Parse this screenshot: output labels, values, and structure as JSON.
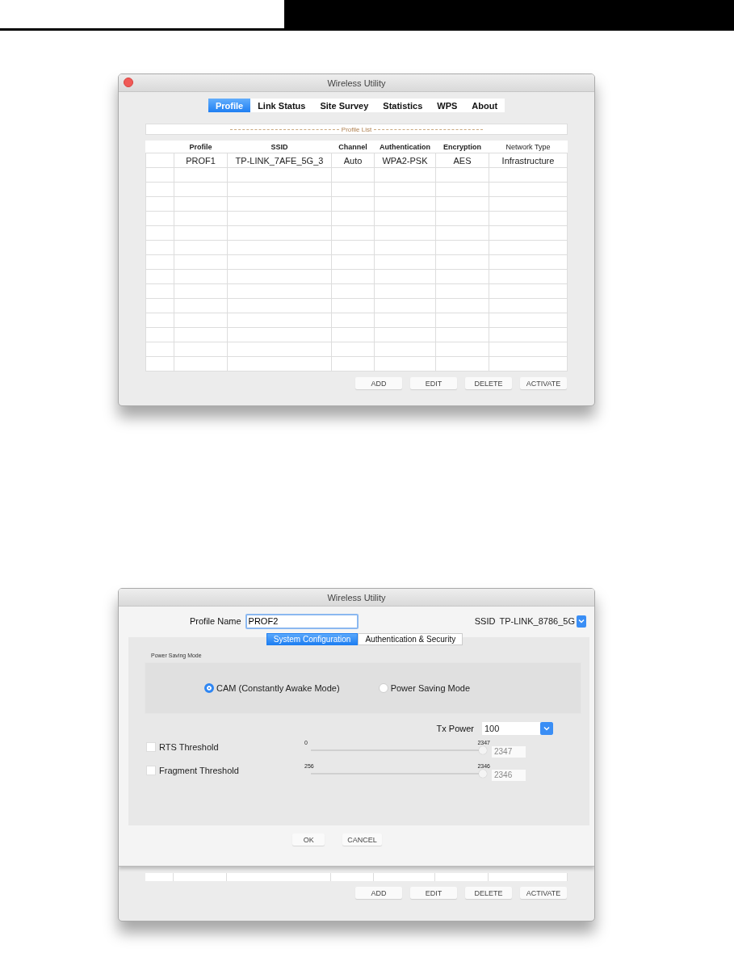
{
  "profile_window": {
    "title": "Wireless Utility",
    "tabs": [
      {
        "label": "Profile",
        "selected": true
      },
      {
        "label": "Link Status",
        "selected": false
      },
      {
        "label": "Site Survey",
        "selected": false
      },
      {
        "label": "Statistics",
        "selected": false
      },
      {
        "label": "WPS",
        "selected": false
      },
      {
        "label": "About",
        "selected": false
      }
    ],
    "list_title": "Profile List",
    "table": {
      "columns": [
        "Profile",
        "SSID",
        "Channel",
        "Authentication",
        "Encryption",
        "Network Type"
      ],
      "rows": [
        [
          "PROF1",
          "TP-LINK_7AFE_5G_3",
          "Auto",
          "WPA2-PSK",
          "AES",
          "Infrastructure"
        ]
      ]
    },
    "buttons": [
      "ADD",
      "EDIT",
      "DELETE",
      "ACTIVATE"
    ]
  },
  "config_window": {
    "title": "Wireless Utility",
    "profile_name": {
      "label": "Profile Name",
      "value": "PROF2"
    },
    "ssid": {
      "label": "SSID",
      "value": "TP-LINK_8786_5G"
    },
    "tabs": [
      {
        "label": "System Configuration",
        "selected": true
      },
      {
        "label": "Authentication & Security",
        "selected": false
      }
    ],
    "power_saving": {
      "title": "Power Saving Mode",
      "options": [
        {
          "label": "CAM (Constantly Awake Mode)",
          "selected": true
        },
        {
          "label": "Power Saving Mode",
          "selected": false
        }
      ]
    },
    "tx_power": {
      "label": "Tx Power",
      "value": "100"
    },
    "thresholds": [
      {
        "label": "RTS Threshold",
        "checked": false,
        "min": "0",
        "max": "2347",
        "level": 1,
        "value": "2347"
      },
      {
        "label": "Fragment Threshold",
        "checked": false,
        "min": "256",
        "max": "2346",
        "level": 1,
        "value": "2346"
      }
    ],
    "buttons": [
      "OK",
      "CANCEL"
    ],
    "background_buttons": [
      "ADD",
      "EDIT",
      "DELETE",
      "ACTIVATE"
    ]
  }
}
